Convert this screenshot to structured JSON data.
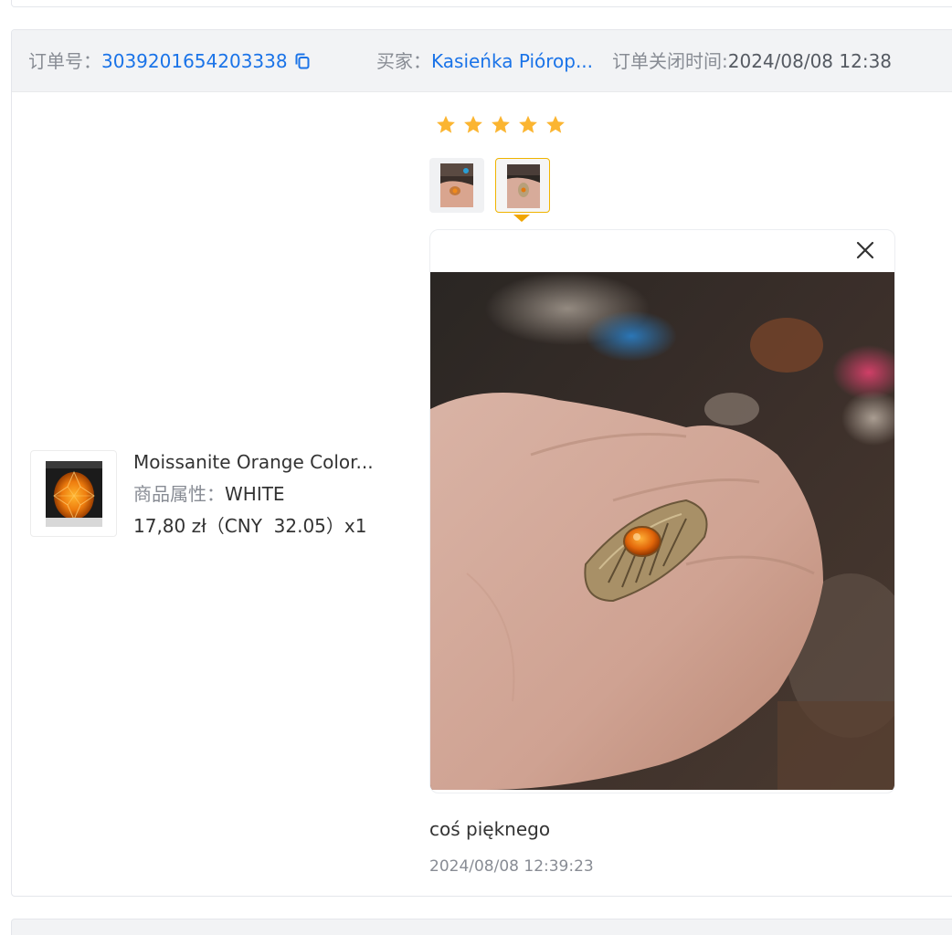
{
  "order": {
    "order_no_label": "订单号：",
    "order_no": "3039201654203338",
    "buyer_label": "买家：",
    "buyer_name": "Kasieńka Piórop...",
    "closed_label": "订单关闭时间:",
    "closed_time": "2024/08/08 12:38"
  },
  "product": {
    "name": "Moissanite Orange Color...",
    "attr_label": "商品属性：",
    "attr_value": "WHITE",
    "price": "17,80 zł（CNY  32.05）x1"
  },
  "review": {
    "rating": 5,
    "rating_max": 5,
    "thumbnail_count": 2,
    "selected_thumbnail": 2,
    "text": "coś pięknego",
    "time": "2024/08/08 12:39:23"
  },
  "colors": {
    "link": "#1a73e8",
    "star": "#fbb531",
    "header_bg": "#f2f3f5",
    "selected_border": "#f0b400"
  },
  "icons": {
    "copy": "copy-icon",
    "star": "star-icon",
    "close": "close-icon"
  }
}
